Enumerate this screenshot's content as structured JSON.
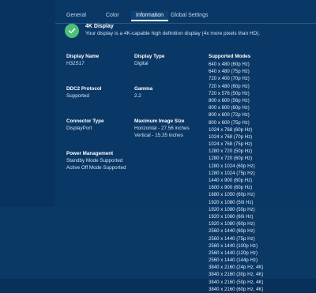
{
  "tabs": [
    "General",
    "Color",
    "Information",
    "Global Settings"
  ],
  "active_tab": "Information",
  "banner": {
    "title": "4K Display",
    "text": "Your display is a 4K-capable high definition display (4x more pixels than HD)."
  },
  "info": {
    "display_name": {
      "label": "Display Name",
      "value": "H32S17"
    },
    "display_type": {
      "label": "Display Type",
      "value": "Digital"
    },
    "ddc2": {
      "label": "DDC2 Protocol",
      "value": "Supported"
    },
    "gamma": {
      "label": "Gamma",
      "value": "2.2"
    },
    "connector": {
      "label": "Connector Type",
      "value": "DisplayPort"
    },
    "max_image": {
      "label": "Maximum Image Size",
      "horizontal": "Horizontal - 27.56 inches",
      "vertical": "Vertical - 15.35 inches"
    },
    "power": {
      "label": "Power Management",
      "standby": "Standby Mode Supported",
      "active_off": "Active Off Mode Supported"
    }
  },
  "supported_modes": {
    "label": "Supported Modes",
    "items": [
      "640 x 480 (60p Hz)",
      "640 x 480 (75p Hz)",
      "720 x 400 (70p Hz)",
      "720 x 480 (60p Hz)",
      "720 x 576 (50p Hz)",
      "800 x 600 (56p Hz)",
      "800 x 600 (60p Hz)",
      "800 x 600 (72p Hz)",
      "800 x 600 (75p Hz)",
      "1024 x 768 (60p Hz)",
      "1024 x 768 (70p Hz)",
      "1024 x 768 (75p Hz)",
      "1280 x 720 (50p Hz)",
      "1280 x 720 (60p Hz)",
      "1280 x 1024 (60p Hz)",
      "1280 x 1024 (75p Hz)",
      "1440 x 900 (60p Hz)",
      "1600 x 900 (60p Hz)",
      "1680 x 1050 (60p Hz)",
      "1920 x 1080 (50i Hz)",
      "1920 x 1080 (50p Hz)",
      "1920 x 1080 (60i Hz)",
      "1920 x 1080 (60p Hz)",
      "2560 x 1440 (60p Hz)",
      "2560 x 1440 (75p Hz)",
      "2560 x 1440 (100p Hz)",
      "2560 x 1440 (120p Hz)",
      "2560 x 1440 (144p Hz)",
      "3840 x 2160 (24p Hz, 4K)",
      "3840 x 2160 (30p Hz, 4K)",
      "3840 x 2160 (50p Hz, 4K)",
      "3840 x 2160 (60p Hz, 4K)"
    ]
  },
  "colors": {
    "background": "#07305a",
    "accent_check": "#4cbf79"
  },
  "icons": {
    "banner": "checkmark-icon"
  }
}
